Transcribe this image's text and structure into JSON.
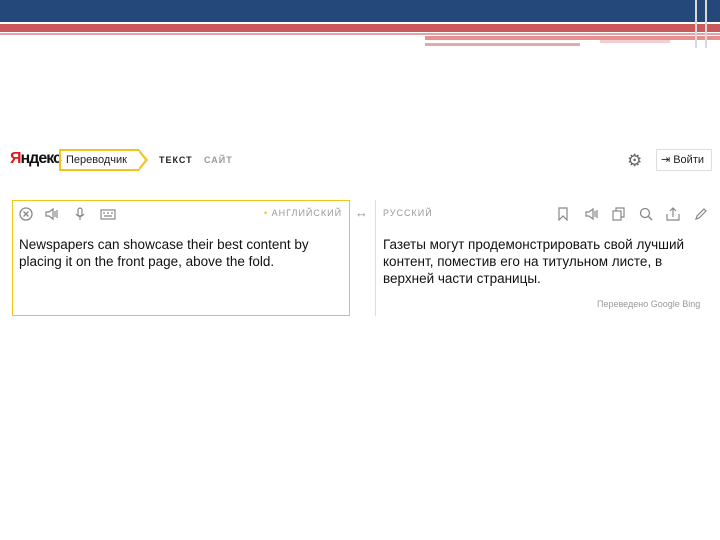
{
  "app": {
    "logo_y": "Я",
    "logo_rest": "ндекс",
    "service": "Переводчик"
  },
  "tabs": [
    {
      "label": "ТЕКСТ",
      "active": true
    },
    {
      "label": "САЙТ",
      "active": false
    }
  ],
  "header": {
    "login_label": "Войти",
    "login_icon": "login-arrow-icon",
    "settings_icon": "gear-icon"
  },
  "source": {
    "language": "АНГЛИЙСКИЙ",
    "text": "Newspapers can showcase their best content by placing it on the front page, above the fold.",
    "icons": [
      "clear-icon",
      "listen-icon",
      "microphone-icon",
      "keyboard-icon"
    ]
  },
  "swap_icon": "swap-arrows-icon",
  "target": {
    "language": "РУССКИЙ",
    "text": "Газеты могут продемонстрировать свой лучший контент, поместив его на титульном листе, в верхней части страницы.",
    "icons": [
      "bookmark-icon",
      "listen-icon",
      "copy-icon",
      "search-icon",
      "share-icon",
      "edit-icon"
    ],
    "credit": "Переведено  Google  Bing"
  },
  "colors": {
    "accent": "#f3c41c",
    "brand_red": "#e31b1b",
    "slide_header_blue": "#24487a",
    "slide_header_red": "#c9595a"
  }
}
